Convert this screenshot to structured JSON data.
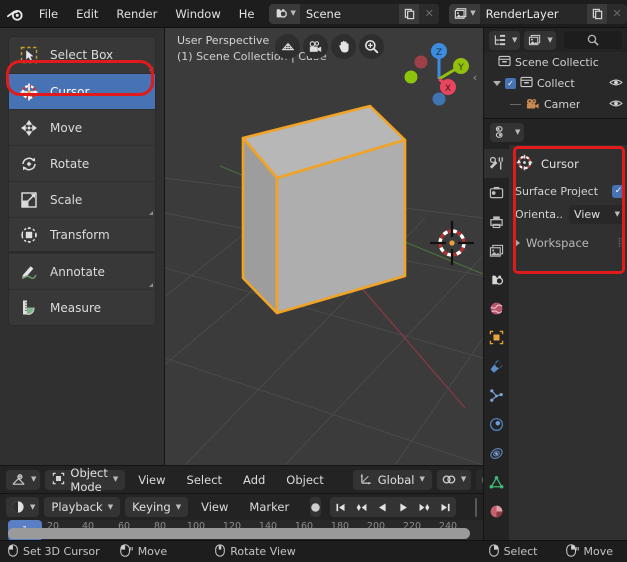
{
  "topbar": {
    "logo_icon": "blender-logo-icon",
    "menus": [
      "File",
      "Edit",
      "Render",
      "Window",
      "He"
    ],
    "scene_browse_icon": "scene-browse-icon",
    "scene_name": "Scene",
    "scene_new_icon": "new-scene-icon",
    "scene_delete_icon": "delete-scene-icon",
    "viewlayer_browse_icon": "viewlayer-browse-icon",
    "viewlayer_name": "RenderLayer",
    "viewlayer_new_icon": "new-viewlayer-icon",
    "viewlayer_delete_icon": "delete-viewlayer-icon"
  },
  "toolbar": {
    "tools": [
      {
        "label": "Select Box",
        "icon": "select-box-icon",
        "active": false,
        "has_corner": true
      },
      {
        "label": "Cursor",
        "icon": "cursor-3d-icon",
        "active": true,
        "has_corner": false
      },
      {
        "label": "Move",
        "icon": "move-icon",
        "active": false,
        "has_corner": false
      },
      {
        "label": "Rotate",
        "icon": "rotate-icon",
        "active": false,
        "has_corner": false
      },
      {
        "label": "Scale",
        "icon": "scale-icon",
        "active": false,
        "has_corner": true
      },
      {
        "label": "Transform",
        "icon": "transform-icon",
        "active": false,
        "has_corner": false
      },
      {
        "label": "Annotate",
        "icon": "annotate-icon",
        "active": false,
        "has_corner": true
      },
      {
        "label": "Measure",
        "icon": "measure-icon",
        "active": false,
        "has_corner": false
      }
    ],
    "highlight_color": "#e11b1b",
    "active_color": "#4772b3"
  },
  "viewport": {
    "perspective_label": "User Perspective",
    "scene_label": "(1) Scene Collection | Cube",
    "gizmo_buttons": [
      {
        "icon": "grid-view-icon"
      },
      {
        "icon": "camera-view-icon"
      },
      {
        "icon": "pan-hand-icon"
      },
      {
        "icon": "zoom-magnifier-icon"
      }
    ],
    "nav_axes": [
      {
        "label": "Z",
        "color": "#3c8ce0"
      },
      {
        "label": "Y",
        "color": "#93c00e"
      },
      {
        "label": "X",
        "color": "#e8465e"
      }
    ],
    "collapse_icon": "chevron-left-icon",
    "object_outline_color": "#f0a324",
    "object_name": "Cube",
    "cursor_3d_icon": "cursor-3d-icon"
  },
  "viewport_footer": {
    "editor_type_icon": "editor-type-3dview-icon",
    "mode_icon": "object-mode-icon",
    "mode_label": "Object Mode",
    "menus": [
      "View",
      "Select",
      "Add",
      "Object"
    ],
    "transform_orientation_icon": "orientation-icon",
    "transform_orientation": "Global",
    "snap_icon": "snap-magnet-icon",
    "proportional_icon": "proportional-edit-icon"
  },
  "timeline": {
    "editor_type_icon": "editor-type-timeline-icon",
    "menus": [
      "Playback",
      "Keying",
      "View",
      "Marker"
    ],
    "record_icon": "auto-keying-record-icon",
    "transport": [
      {
        "icon": "jump-to-start-icon"
      },
      {
        "icon": "prev-keyframe-icon"
      },
      {
        "icon": "play-reverse-icon"
      },
      {
        "icon": "play-icon"
      },
      {
        "icon": "next-keyframe-icon"
      },
      {
        "icon": "jump-to-end-icon"
      }
    ],
    "current_frame": "1",
    "ruler_ticks": [
      "20",
      "40",
      "60",
      "80",
      "100",
      "120",
      "140",
      "160",
      "180",
      "200",
      "220",
      "240"
    ],
    "playhead_color": "#5a7fc4"
  },
  "outliner": {
    "display_mode_icon": "outliner-display-mode-icon",
    "filter_icon": "outliner-filter-icon",
    "search_icon": "search-icon",
    "rows": [
      {
        "name": "Scene Collectic",
        "icon": "scene-collection-icon",
        "indent": 0,
        "has_triangle": false,
        "has_checkbox": false,
        "has_eye": false
      },
      {
        "name": "Collect",
        "icon": "collection-icon",
        "indent": 1,
        "has_triangle": true,
        "has_checkbox": true,
        "has_eye": true
      },
      {
        "name": "Camer",
        "icon": "camera-object-icon",
        "indent": 2,
        "has_triangle": false,
        "has_checkbox": false,
        "has_eye": true
      }
    ]
  },
  "properties": {
    "editor_type_icon": "editor-type-properties-icon",
    "tabs": [
      {
        "icon": "tool-icon",
        "active": true
      },
      {
        "icon": "render-icon",
        "active": false
      },
      {
        "icon": "output-printer-icon",
        "active": false
      },
      {
        "icon": "view-layer-icon",
        "active": false
      },
      {
        "icon": "scene-icon",
        "active": false
      },
      {
        "icon": "world-icon",
        "active": false
      },
      {
        "icon": "object-icon",
        "active": false
      },
      {
        "icon": "modifier-wrench-icon",
        "active": false
      },
      {
        "icon": "particles-icon",
        "active": false
      },
      {
        "icon": "physics-icon",
        "active": false
      },
      {
        "icon": "constraints-icon",
        "active": false
      },
      {
        "icon": "object-data-icon",
        "active": false
      },
      {
        "icon": "material-icon",
        "active": false
      }
    ],
    "tool_title": "Cursor",
    "tool_title_icon": "cursor-3d-icon",
    "surface_project_label": "Surface Project",
    "surface_project_checked": true,
    "orientation_label": "Orienta..",
    "orientation_value": "View",
    "workspace_label": "Workspace",
    "highlight_color": "#e11b1b"
  },
  "statusbar": {
    "items": [
      {
        "icon": "mouse-left-icon",
        "label": "Set 3D Cursor"
      },
      {
        "icon": "mouse-left-drag-icon",
        "label": "Move"
      },
      {
        "icon": "mouse-middle-icon",
        "label": "Rotate View"
      },
      {
        "icon": "mouse-right-icon",
        "label": "Select"
      },
      {
        "icon": "mouse-right-drag-icon",
        "label": "Move"
      }
    ]
  }
}
